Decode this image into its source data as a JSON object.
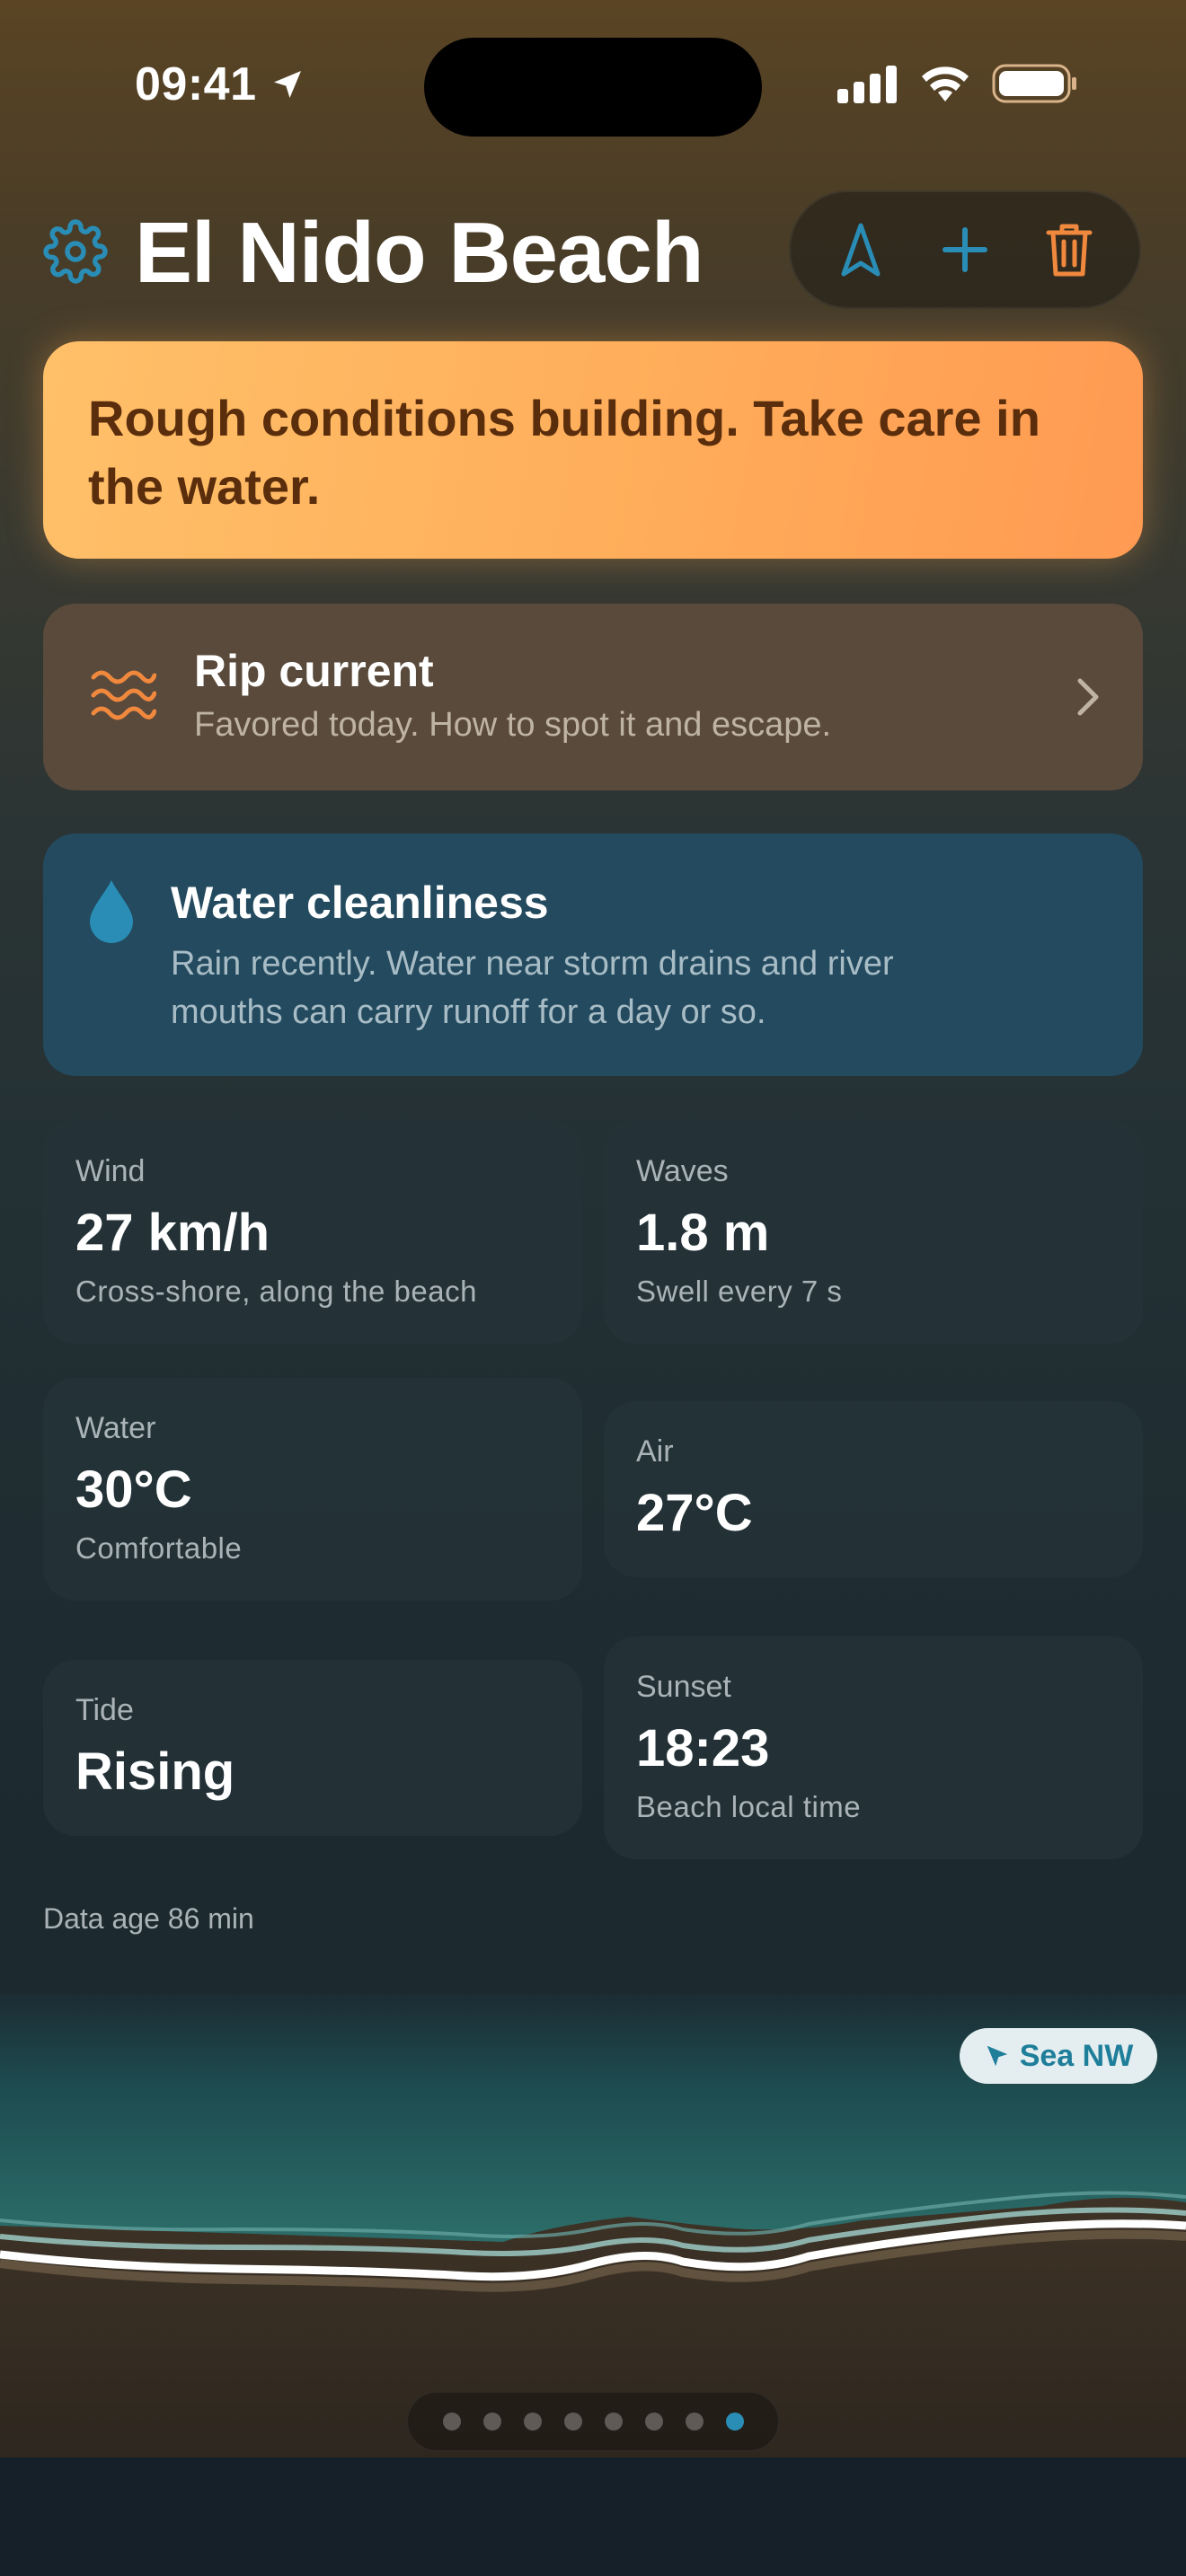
{
  "status_bar": {
    "time": "09:41"
  },
  "header": {
    "title": "El Nido Beach"
  },
  "alert": {
    "text": "Rough conditions building. Take care in the water."
  },
  "rip_card": {
    "title": "Rip current",
    "subtitle": "Favored today. How to spot it and escape."
  },
  "water_card": {
    "title": "Water cleanliness",
    "text": "Rain recently. Water near storm drains and river mouths can carry runoff for a day or so."
  },
  "stats": {
    "wind": {
      "label": "Wind",
      "value": "27 km/h",
      "sub": "Cross-shore, along the beach"
    },
    "waves": {
      "label": "Waves",
      "value": "1.8 m",
      "sub": "Swell every 7 s"
    },
    "water": {
      "label": "Water",
      "value": "30°C",
      "sub": "Comfortable"
    },
    "air": {
      "label": "Air",
      "value": "27°C"
    },
    "tide": {
      "label": "Tide",
      "value": "Rising"
    },
    "sunset": {
      "label": "Sunset",
      "value": "18:23",
      "sub": "Beach local time"
    }
  },
  "data_age": "Data age 86 min",
  "sea_direction": "Sea NW",
  "pager": {
    "count": 8,
    "active_index": 7
  },
  "colors": {
    "accent": "#2a8db6",
    "warning": "#ffad5a",
    "danger": "#f0883e"
  }
}
